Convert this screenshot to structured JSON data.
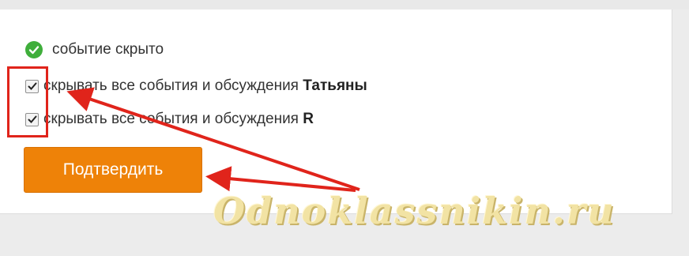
{
  "status": {
    "text": "событие скрыто",
    "icon": "check-circle-icon"
  },
  "options": [
    {
      "prefix": "скрывать все события и обсуждения",
      "name": "Татьяны",
      "checked": true
    },
    {
      "prefix": "скрывать все события и обсуждения",
      "name": "R",
      "checked": true
    }
  ],
  "confirm_button": {
    "label": "Подтвердить"
  },
  "watermark": "Odnoklassnikin.ru",
  "colors": {
    "accent": "#ee8208",
    "highlight": "#e0241b",
    "success": "#3fae3b"
  }
}
